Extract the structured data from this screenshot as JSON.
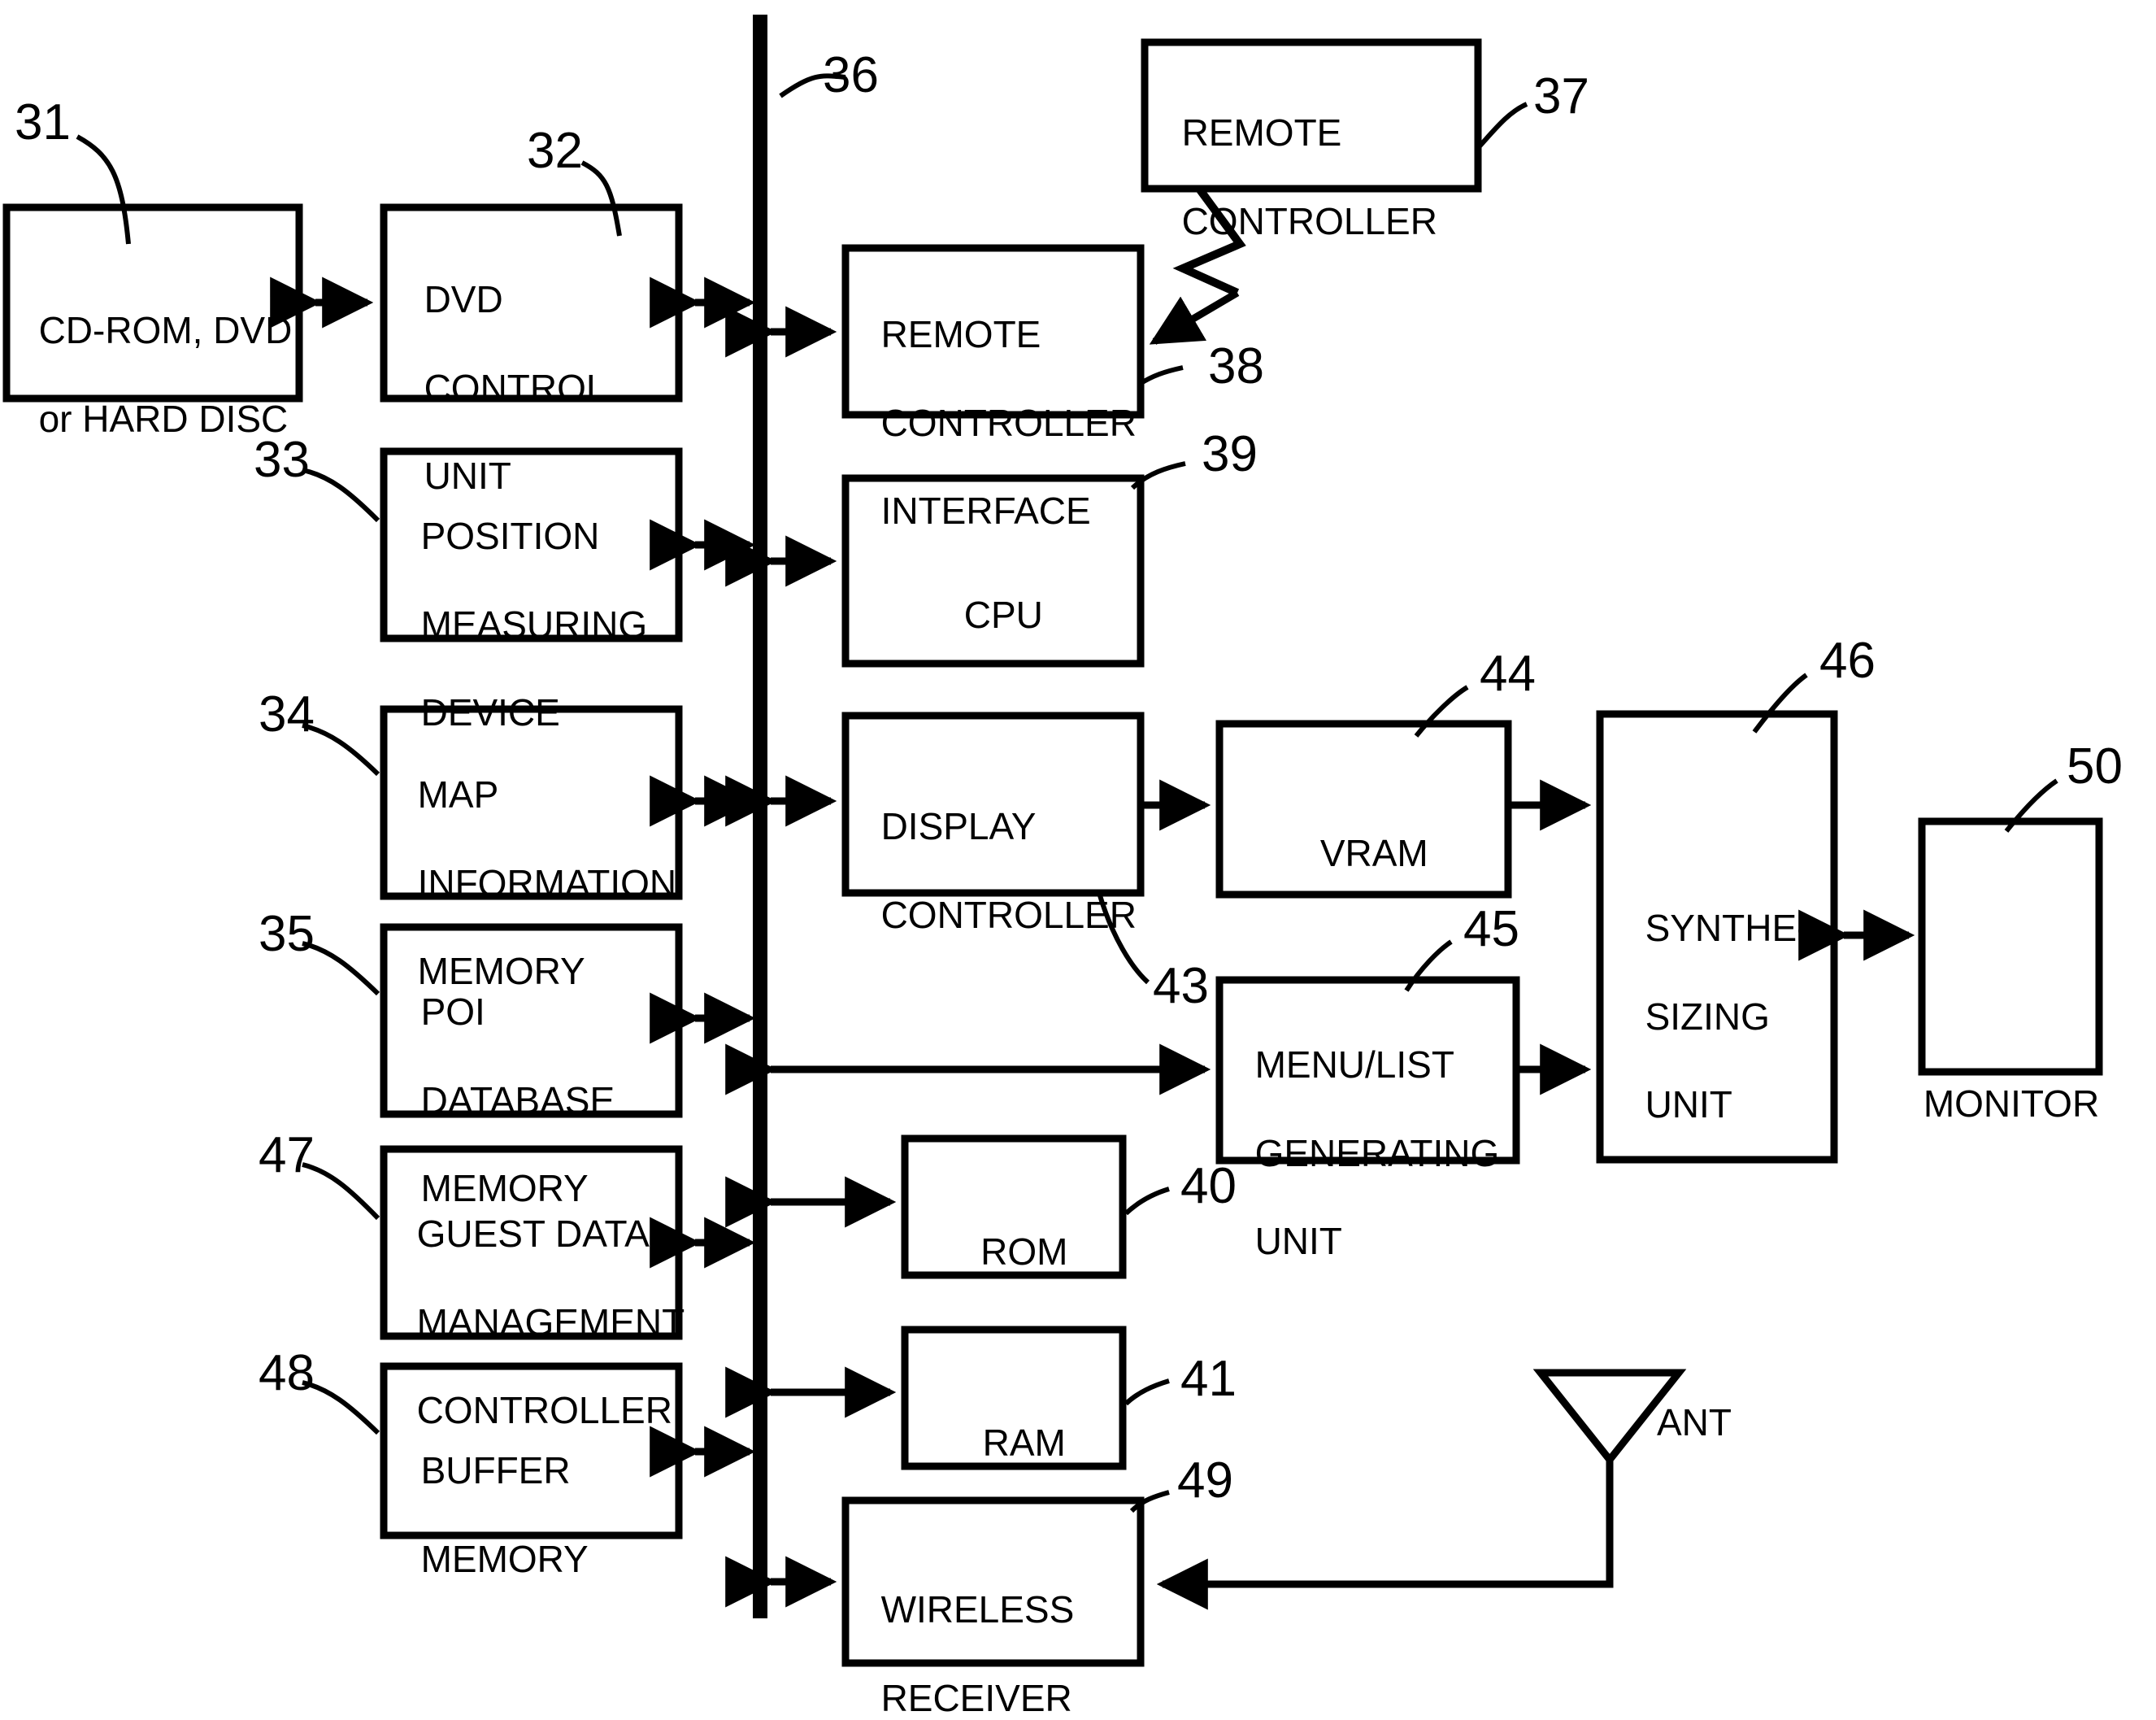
{
  "figure": {
    "type": "patent-block-diagram",
    "subject": "Vehicle navigation / AV system block diagram",
    "bus": {
      "ref": "36",
      "label": ""
    },
    "blocks": [
      {
        "id": "b31",
        "ref": "31",
        "lines": [
          "CD-ROM, DVD,",
          "or HARD DISC"
        ],
        "align": "left"
      },
      {
        "id": "b32",
        "ref": "32",
        "lines": [
          "DVD",
          "CONTROL",
          "UNIT"
        ],
        "align": "left"
      },
      {
        "id": "b33",
        "ref": "33",
        "lines": [
          "POSITION",
          "MEASURING",
          "DEVICE"
        ],
        "align": "left"
      },
      {
        "id": "b34",
        "ref": "34",
        "lines": [
          "MAP",
          "INFORMATION",
          "MEMORY"
        ],
        "align": "left"
      },
      {
        "id": "b35",
        "ref": "35",
        "lines": [
          "POI",
          "DATABASE",
          "MEMORY"
        ],
        "align": "left"
      },
      {
        "id": "b47",
        "ref": "47",
        "lines": [
          "GUEST DATA",
          "MANAGEMENT",
          "CONTROLLER"
        ],
        "align": "left"
      },
      {
        "id": "b48",
        "ref": "48",
        "lines": [
          "BUFFER",
          "MEMORY"
        ],
        "align": "left"
      },
      {
        "id": "b37",
        "ref": "37",
        "lines": [
          "REMOTE",
          "CONTROLLER"
        ],
        "align": "left"
      },
      {
        "id": "b38",
        "ref": "38",
        "lines": [
          "REMOTE",
          "CONTROLLER",
          "INTERFACE"
        ],
        "align": "left"
      },
      {
        "id": "b39",
        "ref": "39",
        "lines": [
          "CPU"
        ],
        "align": "center"
      },
      {
        "id": "b43",
        "ref": "43",
        "lines": [
          "DISPLAY",
          "CONTROLLER"
        ],
        "align": "left"
      },
      {
        "id": "b44",
        "ref": "44",
        "lines": [
          "VRAM"
        ],
        "align": "center"
      },
      {
        "id": "b45",
        "ref": "45",
        "lines": [
          "MENU/LIST",
          "GENERATING",
          "UNIT"
        ],
        "align": "left"
      },
      {
        "id": "b46",
        "ref": "46",
        "lines": [
          "SYNTHE-",
          "SIZING",
          "UNIT"
        ],
        "align": "left"
      },
      {
        "id": "b40",
        "ref": "40",
        "lines": [
          "ROM"
        ],
        "align": "center"
      },
      {
        "id": "b41",
        "ref": "41",
        "lines": [
          "RAM"
        ],
        "align": "center"
      },
      {
        "id": "b49",
        "ref": "49",
        "lines": [
          "WIRELESS",
          "RECEIVER"
        ],
        "align": "left"
      },
      {
        "id": "b50",
        "ref": "50",
        "lines": [],
        "align": "center"
      }
    ],
    "external_labels": [
      {
        "id": "monitor",
        "text": "MONITOR"
      },
      {
        "id": "antenna",
        "text": "ANT"
      }
    ],
    "reference_numerals": [
      "31",
      "32",
      "33",
      "34",
      "35",
      "36",
      "37",
      "38",
      "39",
      "40",
      "41",
      "43",
      "44",
      "45",
      "46",
      "47",
      "48",
      "49",
      "50"
    ],
    "colors": {
      "ink": "#000000",
      "paper": "#ffffff"
    }
  }
}
